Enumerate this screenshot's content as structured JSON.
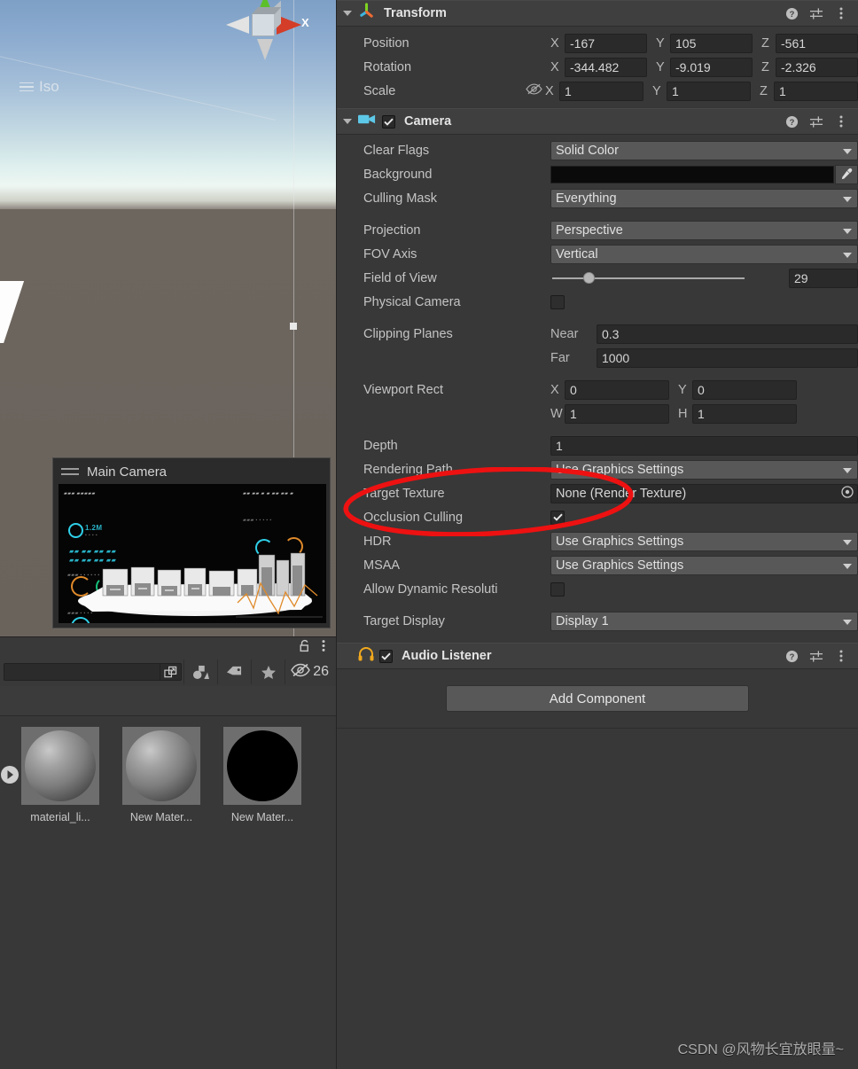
{
  "scene_view": {
    "gizmo_axis_label": "X",
    "projection_label": "Iso",
    "gizmo_icon": "axis-gizmo-icon"
  },
  "camera_preview": {
    "title": "Main Camera",
    "drag_handle_icon": "drag-handle-icon"
  },
  "project_panel": {
    "lock_icon": "lock-icon",
    "menu_icon": "kebab-menu-icon",
    "search_placeholder": "",
    "search_value": "",
    "search_expand_icon": "expand-search-icon",
    "filter_type_icon": "filter-by-type-icon",
    "filter_label_icon": "filter-by-label-icon",
    "favorites_icon": "favorites-star-icon",
    "hidden_icon": "hidden-eye-icon",
    "hidden_count": "26",
    "scroll_arrow_icon": "scroll-right-arrow-icon",
    "assets": [
      {
        "name": "material_li...",
        "thumb": "gray-sphere"
      },
      {
        "name": "New Mater...",
        "thumb": "gray-sphere"
      },
      {
        "name": "New Mater...",
        "thumb": "black-sphere"
      }
    ]
  },
  "inspector": {
    "components": [
      {
        "title": "Transform",
        "icon": "transform-gizmo-icon",
        "has_checkbox": false,
        "help_icon": "help-icon",
        "preset_icon": "preset-icon",
        "menu_icon": "kebab-menu-icon",
        "rows": [
          {
            "label": "Position",
            "x": "-167",
            "y": "105",
            "z": "-561"
          },
          {
            "label": "Rotation",
            "x": "-344.482",
            "y": "-9.019",
            "z": "-2.326"
          },
          {
            "label": "Scale",
            "x": "1",
            "y": "1",
            "z": "1",
            "link_icon": "constrain-proportions-off-icon"
          }
        ],
        "axis_labels": {
          "x": "X",
          "y": "Y",
          "z": "Z"
        }
      },
      {
        "title": "Camera",
        "icon": "camera-icon",
        "has_checkbox": true,
        "checked": true,
        "help_icon": "help-icon",
        "preset_icon": "preset-icon",
        "menu_icon": "kebab-menu-icon"
      },
      {
        "title": "Audio Listener",
        "icon": "headphones-icon",
        "has_checkbox": true,
        "checked": true,
        "help_icon": "help-icon",
        "preset_icon": "preset-icon",
        "menu_icon": "kebab-menu-icon"
      }
    ],
    "camera_fields": {
      "clear_flags": {
        "label": "Clear Flags",
        "value": "Solid Color"
      },
      "background": {
        "label": "Background",
        "color": "#0a0a0a",
        "eyedropper_icon": "eyedropper-icon"
      },
      "culling_mask": {
        "label": "Culling Mask",
        "value": "Everything"
      },
      "projection": {
        "label": "Projection",
        "value": "Perspective"
      },
      "fov_axis": {
        "label": "FOV Axis",
        "value": "Vertical"
      },
      "field_of_view": {
        "label": "Field of View",
        "value": "29",
        "slider_pct": 14
      },
      "physical_camera": {
        "label": "Physical Camera",
        "checked": false
      },
      "clipping_planes": {
        "label": "Clipping Planes",
        "near_label": "Near",
        "near_value": "0.3",
        "far_label": "Far",
        "far_value": "1000"
      },
      "viewport_rect": {
        "label": "Viewport Rect",
        "x_label": "X",
        "x_value": "0",
        "y_label": "Y",
        "y_value": "0",
        "w_label": "W",
        "w_value": "1",
        "h_label": "H",
        "h_value": "1"
      },
      "depth": {
        "label": "Depth",
        "value": "1"
      },
      "rendering_path": {
        "label": "Rendering Path",
        "value": "Use Graphics Settings"
      },
      "target_texture": {
        "label": "Target Texture",
        "value": "None (Render Texture)",
        "picker_icon": "object-picker-icon"
      },
      "occlusion_culling": {
        "label": "Occlusion Culling",
        "checked": true
      },
      "hdr": {
        "label": "HDR",
        "value": "Use Graphics Settings"
      },
      "msaa": {
        "label": "MSAA",
        "value": "Use Graphics Settings"
      },
      "allow_dynamic_resolution": {
        "label": "Allow Dynamic Resoluti",
        "checked": false
      },
      "target_display": {
        "label": "Target Display",
        "value": "Display 1"
      }
    },
    "add_component_label": "Add Component"
  },
  "annotation": {
    "shape": "red-ellipse-highlight",
    "color": "#ee1111",
    "target": "Depth"
  },
  "watermark": "CSDN @风物长宜放眼量~"
}
